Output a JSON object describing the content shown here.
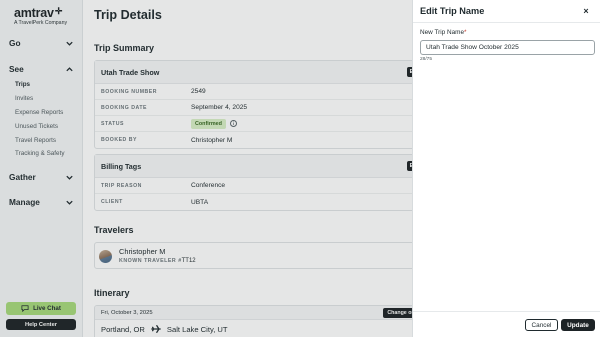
{
  "brand": {
    "name": "amtrav",
    "sub": "A TravelPerk Company"
  },
  "sidebar": {
    "sections": [
      {
        "label": "Go",
        "expanded": false
      },
      {
        "label": "See",
        "expanded": true
      },
      {
        "label": "Gather",
        "expanded": false
      },
      {
        "label": "Manage",
        "expanded": false
      }
    ],
    "see_items": [
      {
        "label": "Trips",
        "active": true
      },
      {
        "label": "Invites",
        "active": false
      },
      {
        "label": "Expense Reports",
        "active": false
      },
      {
        "label": "Unused Tickets",
        "active": false
      },
      {
        "label": "Travel Reports",
        "active": false
      },
      {
        "label": "Tracking & Safety",
        "active": false
      }
    ],
    "live_chat": "Live Chat",
    "help_center": "Help Center"
  },
  "main": {
    "title": "Trip Details",
    "trip_summary": {
      "heading": "Trip Summary",
      "card_title": "Utah Trade Show",
      "rows": [
        {
          "key": "BOOKING NUMBER",
          "value": "2549"
        },
        {
          "key": "BOOKING DATE",
          "value": "September 4, 2025"
        },
        {
          "key": "STATUS",
          "value": "Confirmed"
        },
        {
          "key": "BOOKED BY",
          "value": "Christopher M"
        }
      ]
    },
    "billing": {
      "card_title": "Billing Tags",
      "rows": [
        {
          "key": "TRIP REASON",
          "value": "Conference"
        },
        {
          "key": "CLIENT",
          "value": "UBTA"
        }
      ]
    },
    "travelers": {
      "heading": "Travelers",
      "name": "Christopher M",
      "known_label": "KNOWN TRAVELER #",
      "known_number": "TT12"
    },
    "itinerary": {
      "heading": "Itinerary",
      "date": "Fri, October 3, 2025",
      "change_button": "Change or Can",
      "origin": "Portland, OR",
      "destination": "Salt Lake City, UT"
    }
  },
  "drawer": {
    "title": "Edit Trip Name",
    "close_glyph": "×",
    "field_label": "New Trip Name",
    "required_mark": "*",
    "field_value": "Utah Trade Show October 2025",
    "char_count": "28/75",
    "cancel": "Cancel",
    "update": "Update"
  },
  "colors": {
    "accent_green": "#a7d97b",
    "dark": "#1d2326",
    "confirmed_bg": "#d8efc6"
  }
}
